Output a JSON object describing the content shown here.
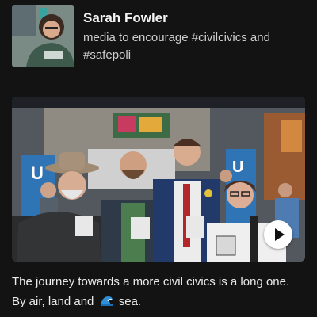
{
  "profile": {
    "name": "Sarah Fowler",
    "bio": "media to encourage #civilcivics and #safepoli"
  },
  "media": {
    "type": "video",
    "play_icon": "play-icon",
    "badge_text": "U"
  },
  "caption": {
    "line1": "The journey towards a more civil civics is a long one.",
    "line2_start": "By air, land and",
    "wave_icon": "wave-emoji-icon",
    "line2_end": "sea."
  },
  "colors": {
    "background": "#131313",
    "text": "#ececec",
    "play_button": "#ffffff"
  }
}
